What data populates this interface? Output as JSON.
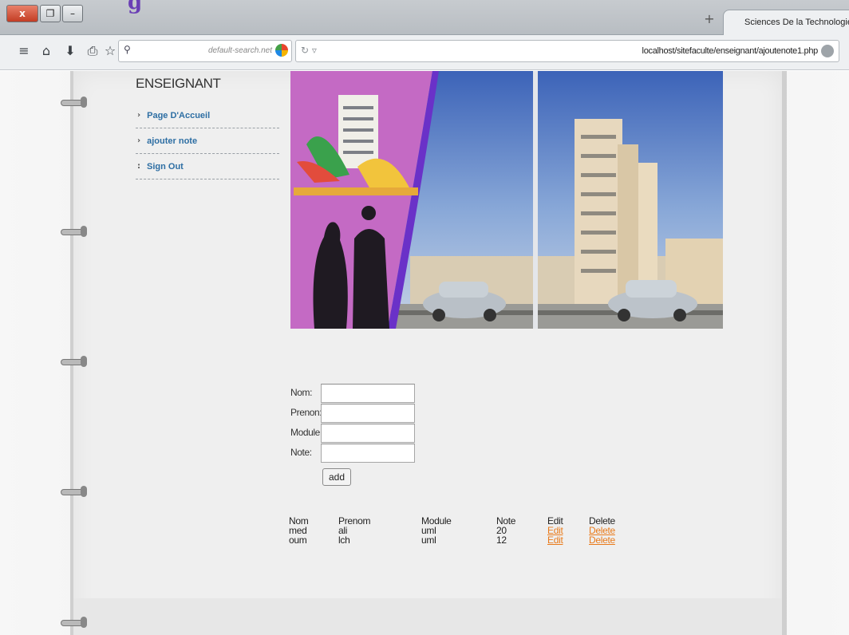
{
  "browser": {
    "title_fragment": "g",
    "new_tab_label": "+",
    "tab_title": "Sciences De la Technologie",
    "search_placeholder": "default-search.net",
    "search_engine_suffix": "▾",
    "url": "localhost/sitefaculte/enseignant/ajoutenote1.php"
  },
  "sidebar": {
    "title": "ENSEIGNANT",
    "items": [
      {
        "label": "Page D'Accueil"
      },
      {
        "label": "ajouter note"
      },
      {
        "label": "Sign Out"
      }
    ]
  },
  "form": {
    "fields": [
      {
        "label": "Nom:",
        "value": ""
      },
      {
        "label": "Prenon:",
        "value": ""
      },
      {
        "label": "Module:",
        "value": ""
      },
      {
        "label": "Note:",
        "value": ""
      }
    ],
    "submit_label": "add"
  },
  "table": {
    "headers": [
      "Nom",
      "Prenom",
      "Module",
      "Note",
      "Edit",
      "Delete"
    ],
    "rows": [
      {
        "nom": "med",
        "prenom": "ali",
        "module": "uml",
        "note": "20",
        "edit": "Edit",
        "delete": "Delete"
      },
      {
        "nom": "oum",
        "prenom": "lch",
        "module": "uml",
        "note": "12",
        "edit": "Edit",
        "delete": "Delete"
      }
    ]
  },
  "colors": {
    "link_orange": "#e97a1a",
    "sidebar_link": "#2d6ea3",
    "banner_purple": "#c46ac4",
    "banner_sky": "#8aa9d8"
  }
}
